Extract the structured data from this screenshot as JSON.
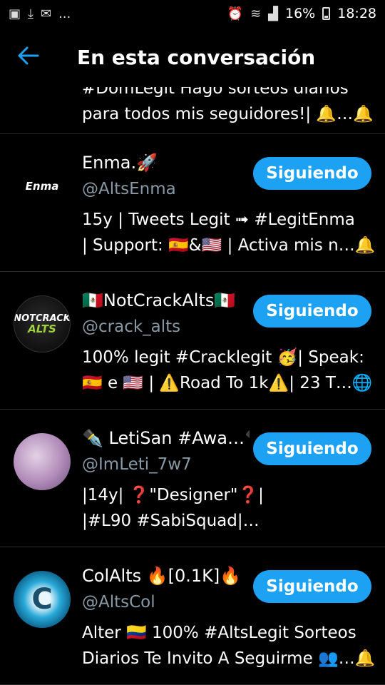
{
  "status_bar": {
    "battery": "16%",
    "time": "18:28",
    "left_icons": [
      "image-icon",
      "download-icon",
      "mail-icon"
    ],
    "left_more": "...",
    "right_icons": [
      "alarm-icon",
      "wifi-icon",
      "signal-icon",
      "battery-icon"
    ]
  },
  "header": {
    "title": "En esta conversación",
    "back_icon": "arrow-left-icon"
  },
  "partial_row": {
    "line1": "#DomLegit Hago sorteos diarios",
    "line2": "para todos mis seguidores!| 🔔…🔔"
  },
  "accounts": [
    {
      "name": "Enma.🚀",
      "handle": "@AltsEnma",
      "avatar_text": "Enma",
      "button": "Siguiendo",
      "bio_line1": "15y | Tweets Legit ➟ #LegitEnma",
      "bio_line2": "| Support: 🇪🇸&🇺🇸 | Activa mis n…🔔"
    },
    {
      "name": "🇲🇽NotCrackAlts🇲🇽",
      "handle": "@crack_alts",
      "avatar_text": "NOTCRACK",
      "avatar_text2": "ALTS",
      "button": "Siguiendo",
      "bio_line1": "100% legit #Cracklegit 🥳| Speak:",
      "bio_line2": "🇪🇸 e 🇺🇸 | ⚠️Road To 1k⚠️| 23 T…🌐"
    },
    {
      "name": "✒️ LetiSan #Awa…✒️",
      "handle": "@ImLeti_7w7",
      "button": "Siguiendo",
      "bio_line1": "|14y| ❓\"Designer\"❓|",
      "bio_line2": "|#L90 #SabiSquad|…"
    },
    {
      "name": "ColAlts 🔥[0.1K]🔥",
      "handle": "@AltsCol",
      "avatar_text": "C",
      "button": "Siguiendo",
      "bio_line1": "Alter 🇨🇴 100% #AltsLegit Sorteos",
      "bio_line2": "Diarios Te Invito A Seguirme 👥…🔔"
    }
  ],
  "colors": {
    "background": "#000000",
    "accent": "#1da1f2",
    "secondary_text": "#8899a6",
    "divider": "#2a2a2a"
  }
}
